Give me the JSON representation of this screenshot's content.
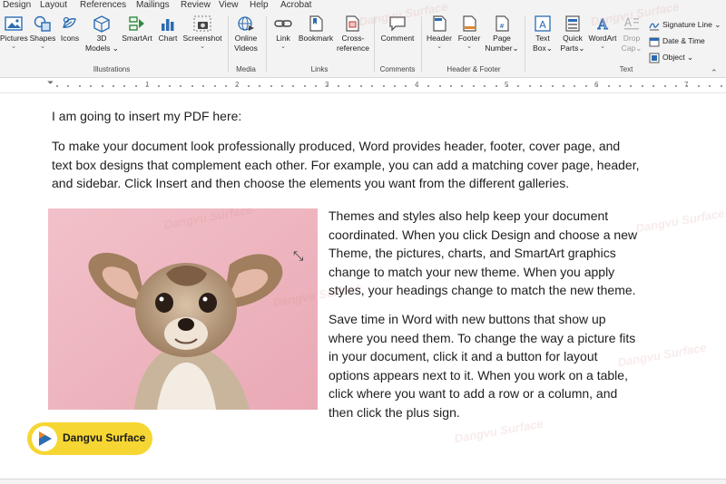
{
  "menu": {
    "tabs": [
      "Design",
      "Layout",
      "References",
      "Mailings",
      "Review",
      "View",
      "Help",
      "Acrobat"
    ]
  },
  "ribbon": {
    "illustrations": {
      "pictures": "Pictures",
      "shapes": "Shapes",
      "icons": "Icons",
      "models": "3D",
      "models2": "Models",
      "smartart": "SmartArt",
      "chart": "Chart",
      "screenshot": "Screenshot",
      "group": "Illustrations"
    },
    "media": {
      "online_videos": "Online",
      "online_videos2": "Videos",
      "group": "Media"
    },
    "links": {
      "link": "Link",
      "bookmark": "Bookmark",
      "cross": "Cross-",
      "cross2": "reference",
      "group": "Links"
    },
    "comments": {
      "comment": "Comment",
      "group": "Comments"
    },
    "header_footer": {
      "header": "Header",
      "footer": "Footer",
      "page_number": "Page",
      "page_number2": "Number",
      "group": "Header & Footer"
    },
    "text": {
      "text_box": "Text",
      "text_box2": "Box",
      "quick_parts": "Quick",
      "quick_parts2": "Parts",
      "wordart": "WordArt",
      "drop_cap": "Drop",
      "drop_cap2": "Cap",
      "signature_line": "Signature Line",
      "date_time": "Date & Time",
      "object": "Object",
      "group": "Text"
    }
  },
  "ruler": {
    "numbers": [
      "1",
      "2",
      "3",
      "4",
      "5",
      "6",
      "7"
    ]
  },
  "document": {
    "para1": "I am going to insert my PDF here:",
    "para2_lines": [
      "To make your document look professionally produced, Word provides header, footer, cover page, and",
      "text box designs that complement each other. For example, you can add a matching cover page, header,",
      "and sidebar. Click Insert and then choose the elements you want from the different galleries."
    ],
    "para3_lines": [
      "Themes and styles also help keep your document",
      "coordinated. When you click Design and choose a new",
      "Theme, the pictures, charts, and SmartArt graphics",
      "change to match your new theme. When you apply",
      "styles, your headings change to match the new theme."
    ],
    "para4_lines": [
      "Save time in Word with new buttons that show up",
      "where you need them. To change the way a picture fits",
      "in your document, click it and a button for layout",
      "options appears next to it. When you work on a table,",
      "click where you want to add a row or a column, and",
      "then click the plus sign."
    ]
  },
  "watermark": {
    "text": "Dangvu Surface"
  },
  "badge": {
    "text": "Dangvu Surface"
  },
  "colors": {
    "accent_blue": "#2b6cb3",
    "photo_pink": "#f0b7c0",
    "badge_yellow": "#f6d633"
  }
}
